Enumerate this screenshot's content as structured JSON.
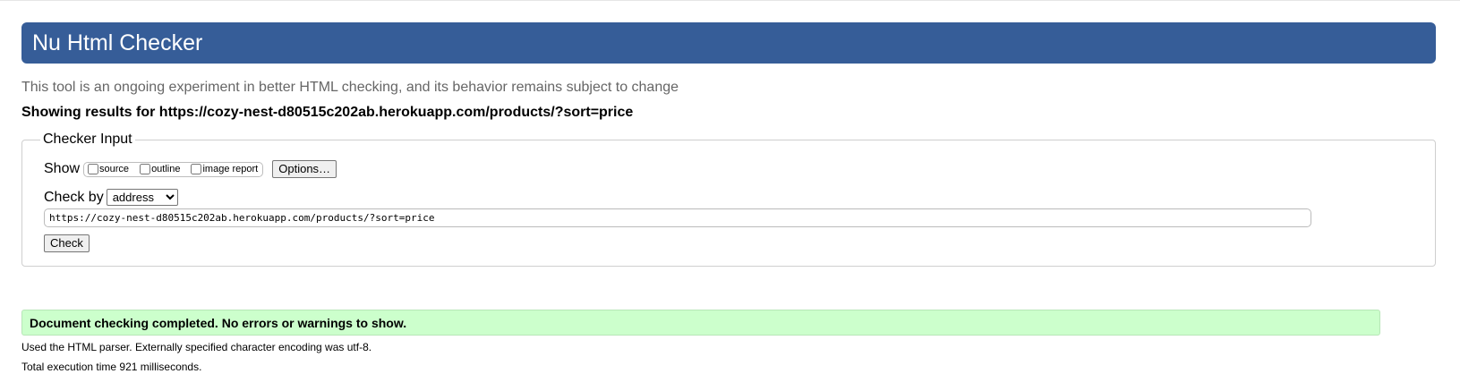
{
  "header": {
    "title": "Nu Html Checker"
  },
  "tagline": "This tool is an ongoing experiment in better HTML checking, and its behavior remains subject to change",
  "results": {
    "prefix": "Showing results for ",
    "url": "https://cozy-nest-d80515c202ab.herokuapp.com/products/?sort=price"
  },
  "checker": {
    "legend": "Checker Input",
    "show_label": "Show",
    "show_options": [
      {
        "label": "source",
        "checked": false
      },
      {
        "label": "outline",
        "checked": false
      },
      {
        "label": "image report",
        "checked": false
      }
    ],
    "options_button": "Options…",
    "check_by_label": "Check by",
    "check_by_selected": "address",
    "url_value": "https://cozy-nest-d80515c202ab.herokuapp.com/products/?sort=price",
    "check_button": "Check"
  },
  "status": {
    "message": "Document checking completed. No errors or warnings to show.",
    "color": "#ccffcc"
  },
  "notes": [
    "Used the HTML parser. Externally specified character encoding was utf-8.",
    "Total execution time 921 milliseconds."
  ],
  "colors": {
    "banner": "#365d98",
    "tagline": "#666666"
  }
}
